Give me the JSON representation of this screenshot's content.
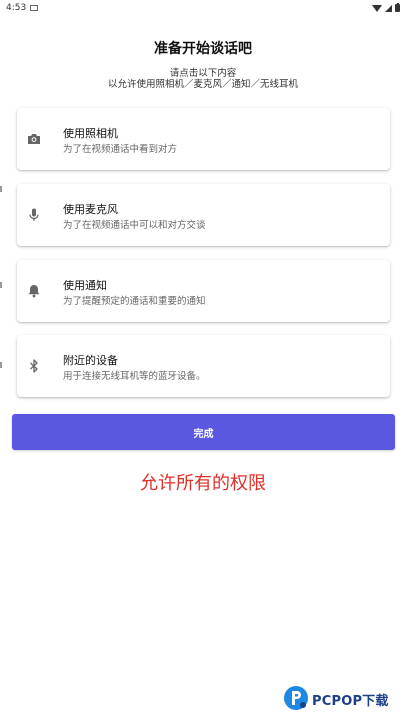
{
  "status_bar": {
    "time": "4:53",
    "icons": [
      "mail-icon",
      "wifi-icon",
      "cell-signal-icon",
      "battery-icon"
    ]
  },
  "header": {
    "title": "准备开始谈话吧",
    "subtitle_line1": "请点击以下内容",
    "subtitle_line2": "以允许使用照相机／麦克风／通知／无线耳机"
  },
  "permissions": [
    {
      "icon": "camera-icon",
      "title": "使用照相机",
      "desc": "为了在视频通话中看到对方"
    },
    {
      "icon": "microphone-icon",
      "title": "使用麦克风",
      "desc": "为了在视频通话中可以和对方交谈"
    },
    {
      "icon": "bell-icon",
      "title": "使用通知",
      "desc": "为了提醒预定的通话和重要的通知"
    },
    {
      "icon": "bluetooth-icon",
      "title": "附近的设备",
      "desc": "用于连接无线耳机等的蓝牙设备。"
    }
  ],
  "done_button": {
    "label": "完成"
  },
  "annotation": "允许所有的权限",
  "watermark": {
    "text": "PCPOP下载"
  },
  "colors": {
    "accent": "#5a58e0",
    "annotation": "#e0302a",
    "watermark": "#1d3f8a"
  }
}
